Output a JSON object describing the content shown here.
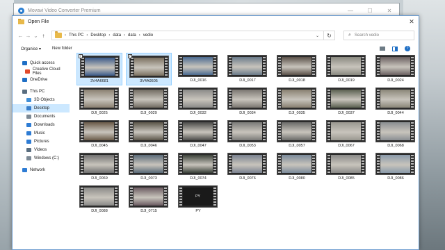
{
  "app": {
    "title": "Movavi Video Converter Premium"
  },
  "dialog": {
    "title": "Open File",
    "breadcrumb": [
      "This PC",
      "Desktop",
      "data",
      "data",
      "vedio"
    ],
    "search_placeholder": "Search vedio",
    "organise_label": "Organise ▾",
    "new_folder_label": "New folder",
    "help": "?"
  },
  "nav": {
    "items": [
      {
        "label": "Quick access",
        "icon": "star-icon",
        "color": "#1f6fc5"
      },
      {
        "label": "Creative Cloud Files",
        "icon": "cc-icon",
        "color": "#e24b2c"
      },
      {
        "label": "OneDrive",
        "icon": "cloud-icon",
        "color": "#1f6fc5"
      },
      {
        "label": "This PC",
        "icon": "pc-icon",
        "color": "#5a6e80"
      },
      {
        "label": "3D Objects",
        "icon": "cube-icon",
        "color": "#3f8fd8"
      },
      {
        "label": "Desktop",
        "icon": "desktop-icon",
        "color": "#3a7fcb"
      },
      {
        "label": "Documents",
        "icon": "document-icon",
        "color": "#7d8a96"
      },
      {
        "label": "Downloads",
        "icon": "download-icon",
        "color": "#2e7cd4"
      },
      {
        "label": "Music",
        "icon": "music-icon",
        "color": "#2e7cd4"
      },
      {
        "label": "Pictures",
        "icon": "picture-icon",
        "color": "#2e7cd4"
      },
      {
        "label": "Videos",
        "icon": "video-icon",
        "color": "#5a6e80"
      },
      {
        "label": "Windows (C:)",
        "icon": "drive-icon",
        "color": "#7d8a96"
      },
      {
        "label": "Network",
        "icon": "network-icon",
        "color": "#2e7cd4"
      }
    ],
    "selected": "Desktop"
  },
  "files": [
    {
      "name": "3V4A6681",
      "selected": true,
      "color": "#3a5a8a"
    },
    {
      "name": "3V4A9505",
      "selected": true,
      "color": "#7a7060"
    },
    {
      "name": "DJI_0016",
      "color": "#4a6a90"
    },
    {
      "name": "DJI_0017",
      "color": "#6a7a8a"
    },
    {
      "name": "DJI_0018",
      "color": "#5a5048"
    },
    {
      "name": "DJI_0019",
      "color": "#8a8a80"
    },
    {
      "name": "DJI_0024",
      "color": "#6a6060"
    },
    {
      "name": "DJI_0025",
      "color": "#8a8070"
    },
    {
      "name": "DJI_0029",
      "color": "#706a60"
    },
    {
      "name": "DJI_0032",
      "color": "#8a8a88"
    },
    {
      "name": "DJI_0034",
      "color": "#7a7670"
    },
    {
      "name": "DJI_0035",
      "color": "#888070"
    },
    {
      "name": "DJI_0037",
      "color": "#5a6050"
    },
    {
      "name": "DJI_0044",
      "color": "#8a8678"
    },
    {
      "name": "DJI_0045",
      "color": "#6a5a48"
    },
    {
      "name": "DJI_0046",
      "color": "#5a5448"
    },
    {
      "name": "DJI_0047",
      "color": "#4a4a48"
    },
    {
      "name": "DJI_0053",
      "color": "#7a7a78"
    },
    {
      "name": "DJI_0057",
      "color": "#6a6a68"
    },
    {
      "name": "DJI_0067",
      "color": "#9a9890"
    },
    {
      "name": "DJI_0068",
      "color": "#8a8e92"
    },
    {
      "name": "DJI_0069",
      "color": "#707070"
    },
    {
      "name": "DJI_0073",
      "color": "#5a6a78"
    },
    {
      "name": "DJI_0074",
      "color": "#3a4038"
    },
    {
      "name": "DJI_0076",
      "color": "#7a8290"
    },
    {
      "name": "DJI_0080",
      "color": "#7a8a9a"
    },
    {
      "name": "DJI_0085",
      "color": "#8a8a88"
    },
    {
      "name": "DJI_0086",
      "color": "#8a9aaa"
    },
    {
      "name": "DJI_0088",
      "color": "#8a8a88"
    },
    {
      "name": "DJI_0715",
      "color": "#6a5a60"
    },
    {
      "name": "PY",
      "color": "#1a1a1a",
      "text": "PY"
    }
  ]
}
